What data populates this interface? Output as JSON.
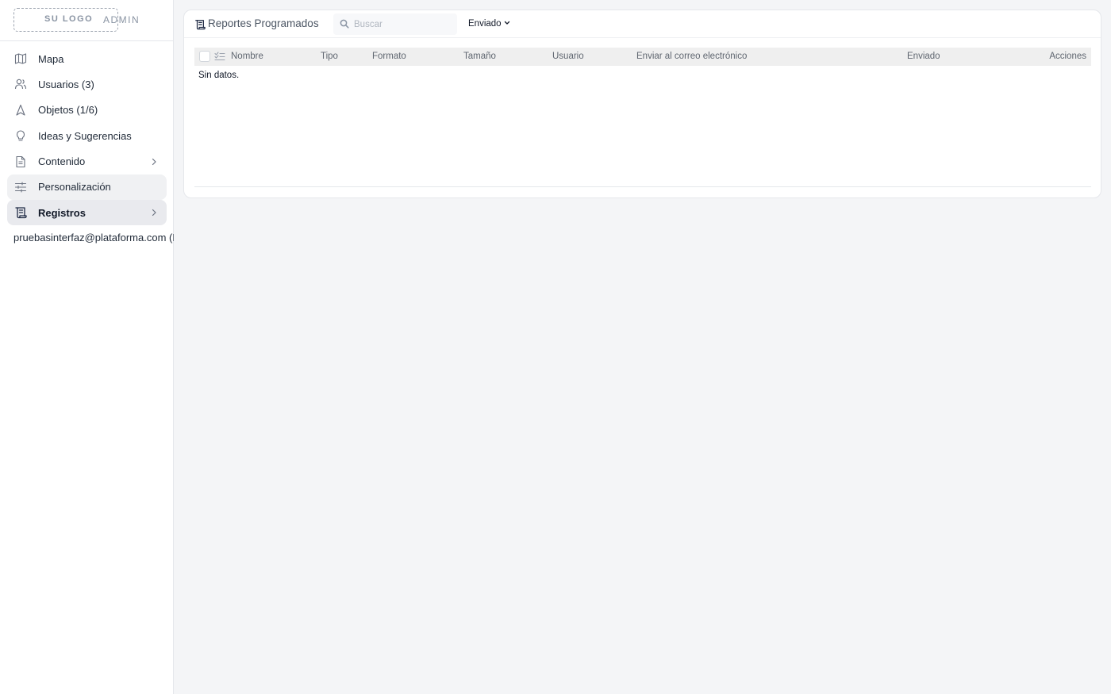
{
  "brand": {
    "logo": "SU LOGO",
    "admin": "ADMIN"
  },
  "sidebar": {
    "items": [
      {
        "label": "Mapa",
        "icon": "map-icon"
      },
      {
        "label": "Usuarios (3)",
        "icon": "users-icon"
      },
      {
        "label": "Objetos (1/6)",
        "icon": "navigation-icon"
      },
      {
        "label": "Ideas y Sugerencias",
        "icon": "lightbulb-icon"
      },
      {
        "label": "Contenido",
        "icon": "document-icon",
        "has_submenu": true
      },
      {
        "label": "Personalización",
        "icon": "sliders-icon"
      },
      {
        "label": "Registros",
        "icon": "scroll-icon",
        "has_submenu": true,
        "current": true
      }
    ],
    "user_email": "pruebasinterfaz@plataforma.com (D"
  },
  "main": {
    "title": "Reportes Programados",
    "search": {
      "placeholder": "Buscar",
      "value": ""
    },
    "filter": {
      "selected": "Enviado"
    },
    "table": {
      "columns": [
        "Nombre",
        "Tipo",
        "Formato",
        "Tamaño",
        "Usuario",
        "Enviar al correo electrónico",
        "Enviado",
        "Acciones"
      ],
      "empty_text": "Sin datos."
    }
  },
  "colors": {
    "active_bg": "#e9eaee",
    "background": "#f4f5f7",
    "header_row": "#efefef"
  }
}
